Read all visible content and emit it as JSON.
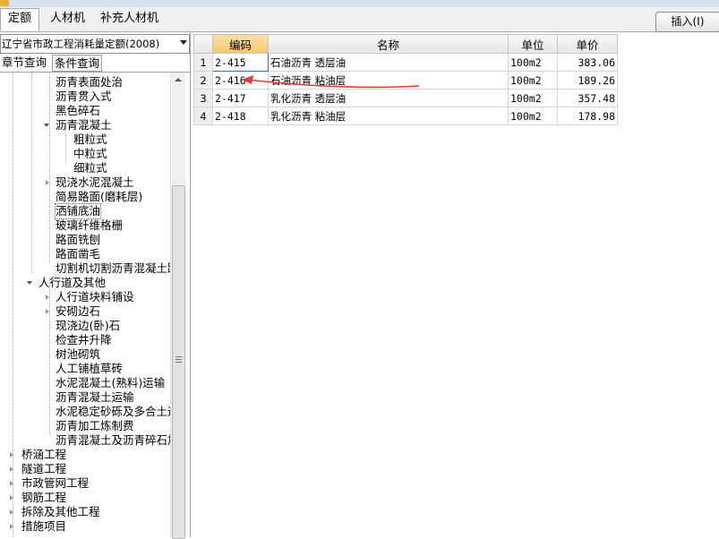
{
  "tabs": [
    {
      "label": "定额",
      "active": true
    },
    {
      "label": "人材机",
      "active": false
    },
    {
      "label": "补充人材机",
      "active": false
    }
  ],
  "insert_button": "插入(I)",
  "quota_library": "辽宁省市政工程消耗量定额(2008)",
  "subtabs": [
    "章节查询",
    "条件查询"
  ],
  "tree": [
    {
      "label": "沥青表面处治"
    },
    {
      "label": "沥青贯入式"
    },
    {
      "label": "黑色碎石"
    },
    {
      "label": "沥青混凝土"
    },
    {
      "label": "粗粒式"
    },
    {
      "label": "中粒式"
    },
    {
      "label": "细粒式"
    },
    {
      "label": "现浇水泥混凝土"
    },
    {
      "label": "简易路面(磨耗层)"
    },
    {
      "label": "洒铺底油",
      "selected": true
    },
    {
      "label": "玻璃纤维格栅"
    },
    {
      "label": "路面铣刨"
    },
    {
      "label": "路面凿毛"
    },
    {
      "label": "切割机切割沥青混凝土路"
    },
    {
      "label": "人行道及其他"
    },
    {
      "label": "人行道块料铺设"
    },
    {
      "label": "安砌边石"
    },
    {
      "label": "现浇边(卧)石"
    },
    {
      "label": "检查井升降"
    },
    {
      "label": "树池砌筑"
    },
    {
      "label": "人工铺植草砖"
    },
    {
      "label": "水泥混凝土(熟料)运输"
    },
    {
      "label": "沥青混凝土运输"
    },
    {
      "label": "水泥稳定砂砾及多合土运"
    },
    {
      "label": "沥青加工炼制费"
    },
    {
      "label": "沥青混凝土及沥青碎石加"
    },
    {
      "label": "桥涵工程"
    },
    {
      "label": "隧道工程"
    },
    {
      "label": "市政管网工程"
    },
    {
      "label": "钢筋工程"
    },
    {
      "label": "拆除及其他工程"
    },
    {
      "label": "措施项目"
    }
  ],
  "grid": {
    "headers": {
      "code": "编码",
      "name": "名称",
      "unit": "单位",
      "price": "单价"
    },
    "rows": [
      {
        "no": "1",
        "code": "2-415",
        "name": "石油沥青 透层油",
        "unit": "100m2",
        "price": "383.06"
      },
      {
        "no": "2",
        "code": "2-416",
        "name": "石油沥青 粘油层",
        "unit": "100m2",
        "price": "189.26"
      },
      {
        "no": "3",
        "code": "2-417",
        "name": "乳化沥青 透层油",
        "unit": "100m2",
        "price": "357.48"
      },
      {
        "no": "4",
        "code": "2-418",
        "name": "乳化沥青 粘油层",
        "unit": "100m2",
        "price": "178.98"
      }
    ]
  },
  "colors": {
    "annotation_arrow": "#e53935",
    "header_highlight": "#f3c66c"
  }
}
